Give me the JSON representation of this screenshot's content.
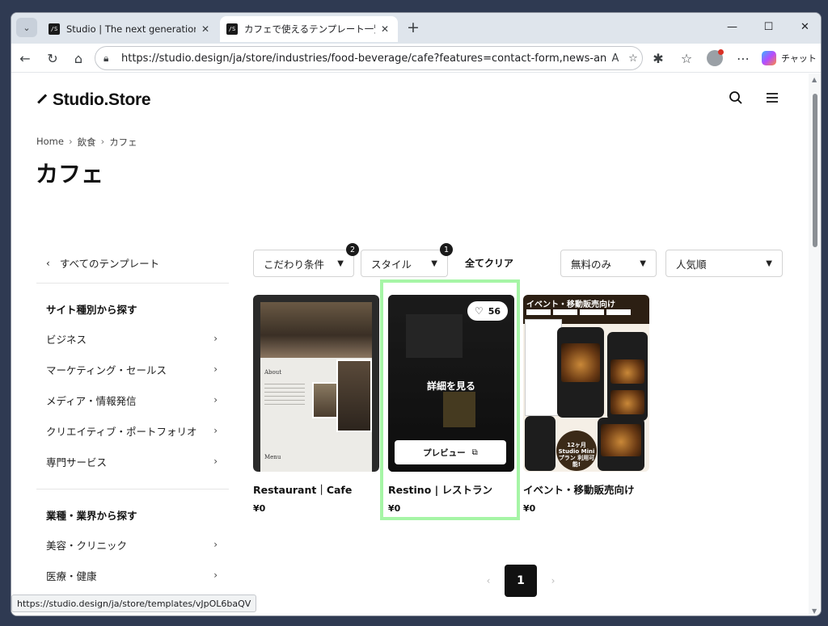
{
  "browser": {
    "tabs": [
      {
        "title": "Studio | The next generation desig",
        "favicon": "studio-logo"
      },
      {
        "title": "カフェで使えるテンプレート一覧 | Studio",
        "favicon": "studio-logo"
      }
    ],
    "url": "https://studio.design/ja/store/industries/food-beverage/cafe?features=contact-form,news-announce...",
    "copilot_label": "チャット",
    "status_url": "https://studio.design/ja/store/templates/vJpOL6baQV"
  },
  "site": {
    "logo": "Studio.Store",
    "breadcrumb": [
      "Home",
      "飲食",
      "カフェ"
    ],
    "page_title": "カフェ"
  },
  "sidebar": {
    "all_templates": "すべてのテンプレート",
    "section1_title": "サイト種別から探す",
    "section1_items": [
      "ビジネス",
      "マーケティング・セールス",
      "メディア・情報発信",
      "クリエイティブ・ポートフォリオ",
      "専門サービス"
    ],
    "section2_title": "業種・業界から探す",
    "section2_items": [
      "美容・クリニック",
      "医療・健康"
    ]
  },
  "filters": {
    "conditions": {
      "label": "こだわり条件",
      "count": "2"
    },
    "style": {
      "label": "スタイル",
      "count": "1"
    },
    "clear_all": "全てクリア",
    "price": "無料のみ",
    "sort": "人気順"
  },
  "cards": [
    {
      "title": "Restaurant｜Cafe",
      "price": "¥0",
      "thumb_about": "About",
      "thumb_menu": "Menu"
    },
    {
      "title": "Restino | レストラン",
      "price": "¥0",
      "likes": "56",
      "details_label": "詳細を見る",
      "preview_label": "プレビュー"
    },
    {
      "title": "イベント・移動販売向け",
      "price": "¥0",
      "thumb_banner": "イベント・移動販売向け",
      "thumb_badge": "12ヶ月 Studio Miniプラン 利用可能!"
    }
  ],
  "pagination": {
    "current": "1"
  },
  "colors": {
    "highlight": "#a6f5a6",
    "dark": "#111111"
  }
}
